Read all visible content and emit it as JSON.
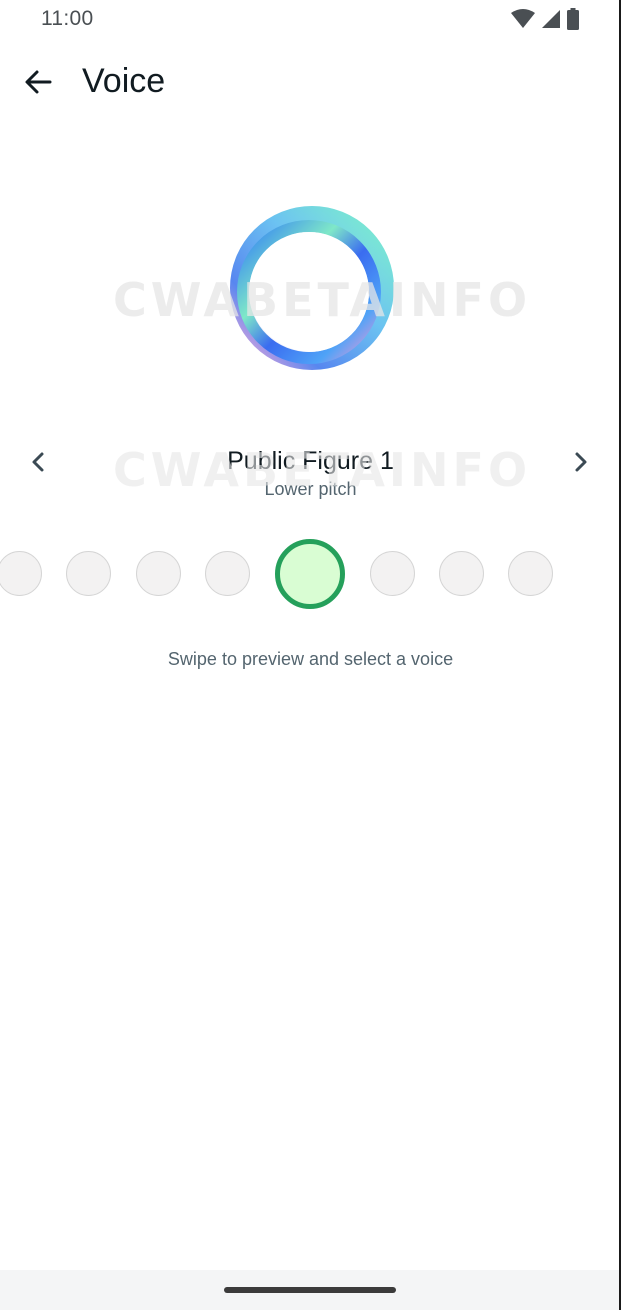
{
  "status_bar": {
    "time": "11:00",
    "icons": [
      "wifi-icon",
      "signal-icon",
      "battery-icon"
    ]
  },
  "header": {
    "title": "Voice",
    "back_icon": "arrow-back-icon"
  },
  "watermark": {
    "text": "CWABETAINFO"
  },
  "voice": {
    "name": "Public Figure 1",
    "description": "Lower pitch",
    "prev_icon": "chevron-left-icon",
    "next_icon": "chevron-right-icon"
  },
  "carousel": {
    "count": 8,
    "selected_index": 4
  },
  "hint": "Swipe to preview and select a voice",
  "colors": {
    "accent": "#25a05b",
    "selected_fill": "#d9fdd3",
    "text_primary": "#111b21",
    "text_secondary": "#54656f"
  }
}
